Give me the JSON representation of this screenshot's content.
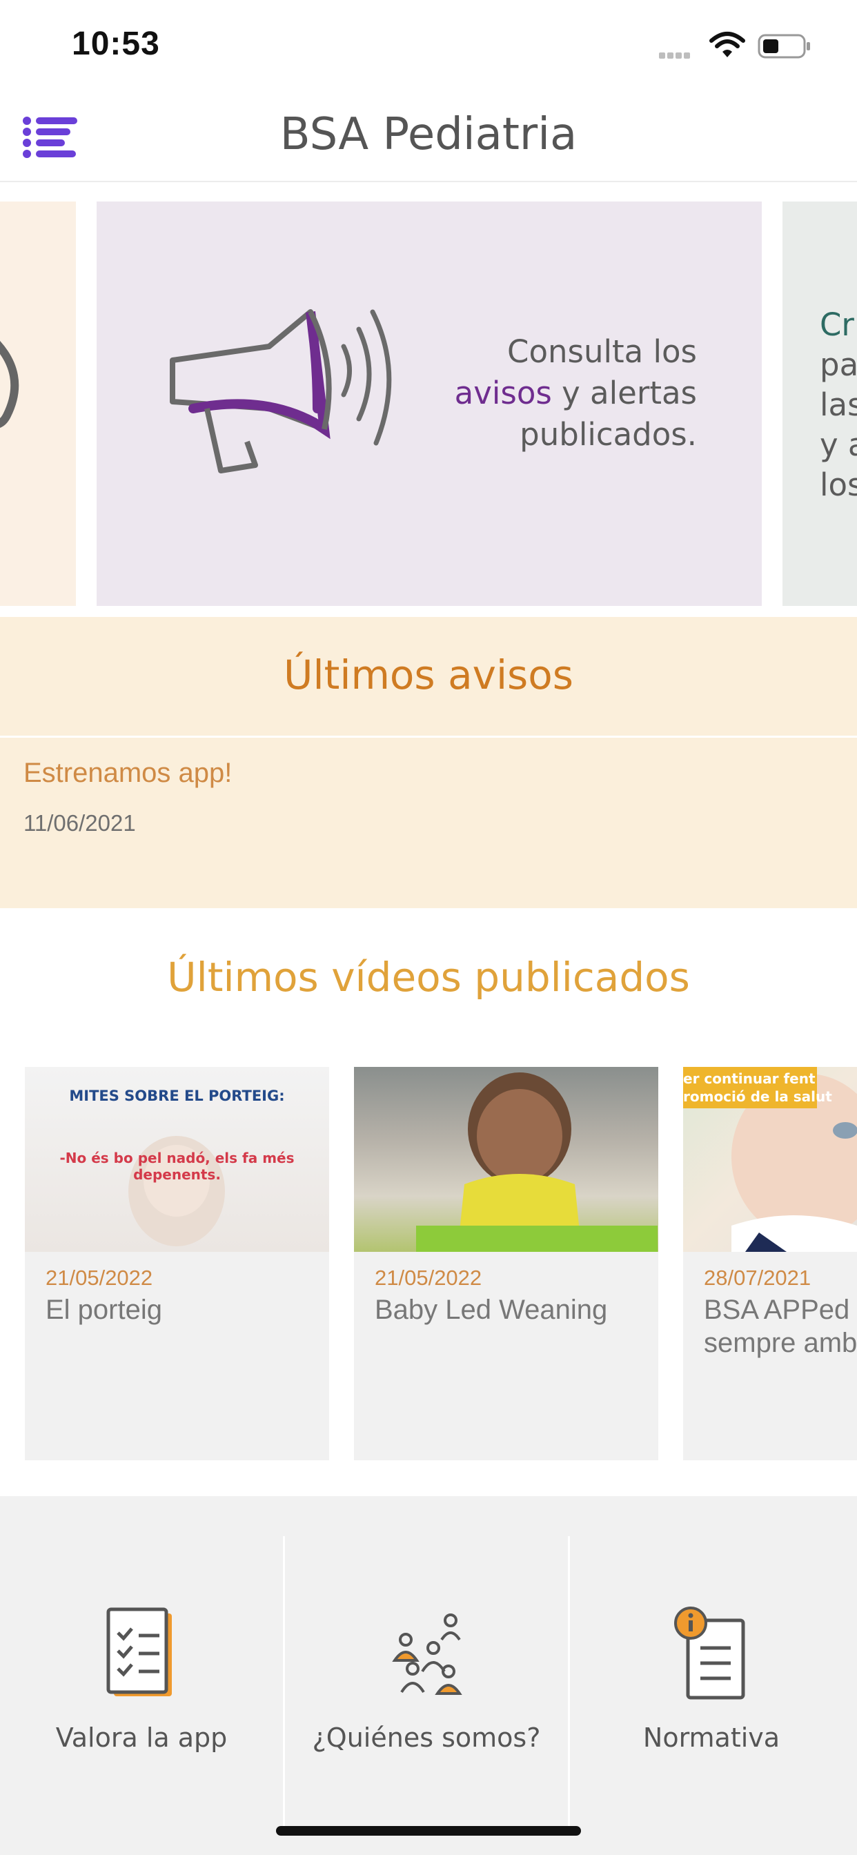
{
  "status_bar": {
    "time": "10:53"
  },
  "header": {
    "title": "BSA Pediatria"
  },
  "carousel": {
    "main": {
      "text_before": "Consulta los",
      "text_highlight": "avisos",
      "text_after": "y alertas publicados."
    },
    "right_peek": {
      "line1": "Cr",
      "line2": "par",
      "line3": "las",
      "line4": "y a",
      "line5": "los"
    }
  },
  "avisos": {
    "title": "Últimos avisos",
    "items": [
      {
        "title": "Estrenamos app!",
        "date": "11/06/2021"
      }
    ]
  },
  "videos": {
    "title": "Últimos vídeos publicados",
    "items": [
      {
        "date": "21/05/2022",
        "title": "El porteig",
        "thumb_line1": "MITES SOBRE EL PORTEIG:",
        "thumb_line2": "-No és bo pel nadó, els fa més depenents."
      },
      {
        "date": "21/05/2022",
        "title": "Baby Led Weaning"
      },
      {
        "date": "28/07/2021",
        "title_line1": "BSA APPed",
        "title_line2": "sempre amb",
        "thumb_banner": "er continuar fent\nromoció de la salut"
      }
    ]
  },
  "bottom_tiles": [
    {
      "label": "Valora la app",
      "icon": "checklist-icon"
    },
    {
      "label": "¿Quiénes somos?",
      "icon": "people-icon"
    },
    {
      "label": "Normativa",
      "icon": "document-info-icon"
    }
  ],
  "colors": {
    "accent_purple": "#6f2d8f",
    "menu_purple": "#6a3fd8",
    "orange": "#cf7b22",
    "gold": "#e0a23a"
  }
}
